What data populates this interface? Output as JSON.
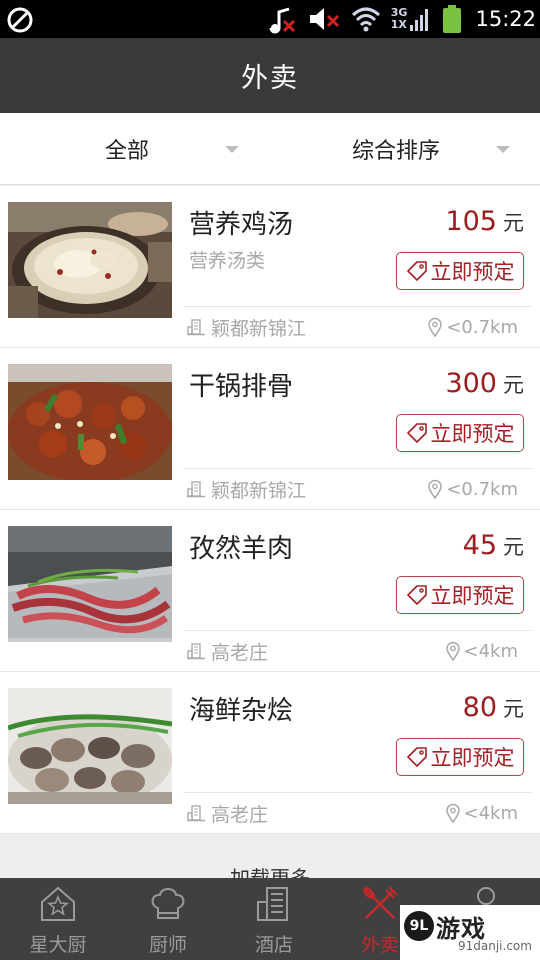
{
  "status_bar": {
    "time": "15:22",
    "network_top": "3G",
    "network_bottom": "1X",
    "icons": [
      "no-disturb-icon",
      "music-off-icon",
      "mute-icon",
      "wifi-icon",
      "signal-icon",
      "battery-icon"
    ]
  },
  "header": {
    "title": "外卖"
  },
  "filters": {
    "category": "全部",
    "sort": "综合排序"
  },
  "items": [
    {
      "name": "营养鸡汤",
      "category": "营养汤类",
      "price": "105",
      "unit": "元",
      "book_label": "立即预定",
      "location": "颖都新锦江",
      "distance": "<0.7km"
    },
    {
      "name": "干锅排骨",
      "category": "",
      "price": "300",
      "unit": "元",
      "book_label": "立即预定",
      "location": "颖都新锦江",
      "distance": "<0.7km"
    },
    {
      "name": "孜然羊肉",
      "category": "",
      "price": "45",
      "unit": "元",
      "book_label": "立即预定",
      "location": "高老庄",
      "distance": "<4km"
    },
    {
      "name": "海鲜杂烩",
      "category": "",
      "price": "80",
      "unit": "元",
      "book_label": "立即预定",
      "location": "高老庄",
      "distance": "<4km"
    }
  ],
  "load_more": "加载更多",
  "tabs": [
    {
      "label": "星大厨",
      "icon": "star-house-icon",
      "active": false
    },
    {
      "label": "厨师",
      "icon": "chef-hat-icon",
      "active": false
    },
    {
      "label": "酒店",
      "icon": "hotel-icon",
      "active": false
    },
    {
      "label": "外卖",
      "icon": "fork-knife-icon",
      "active": true
    },
    {
      "label": "",
      "icon": "profile-icon",
      "active": false
    }
  ],
  "watermark": {
    "logo": "9L",
    "title": "游戏",
    "url": "91danji.com"
  },
  "colors": {
    "accent": "#a51f24",
    "header_bg": "#3a3a3a",
    "tabbar_bg": "#404040"
  }
}
